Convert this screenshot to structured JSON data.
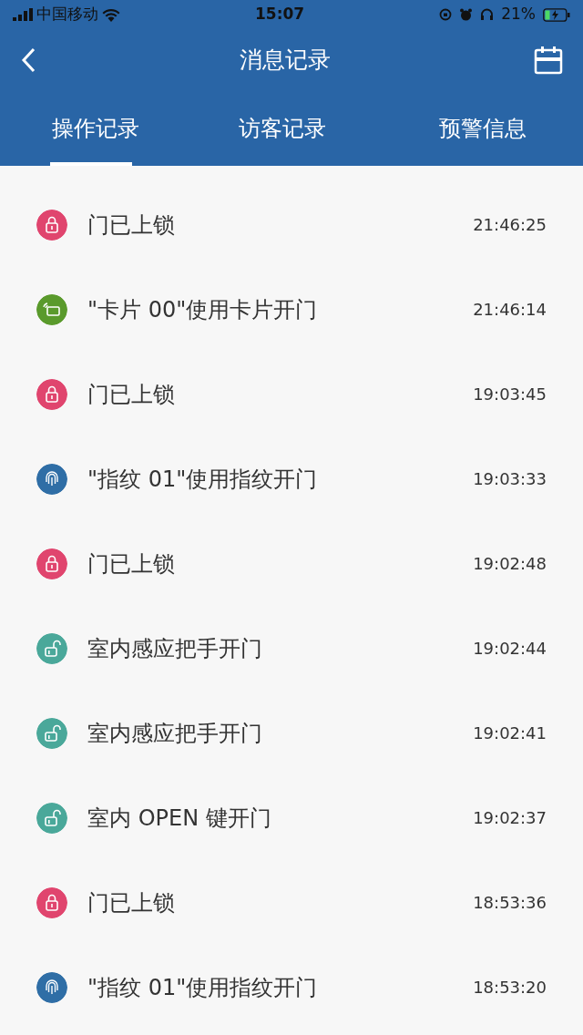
{
  "status_bar": {
    "carrier": "中国移动",
    "time": "15:07",
    "battery": "21%"
  },
  "header": {
    "title": "消息记录"
  },
  "tabs": [
    {
      "label": "操作记录",
      "selected": true
    },
    {
      "label": "访客记录",
      "selected": false
    },
    {
      "label": "预警信息",
      "selected": false
    }
  ],
  "records": [
    {
      "kind": "lock",
      "text": "门已上锁",
      "time": "21:46:25"
    },
    {
      "kind": "card",
      "text": "\"卡片 00\"使用卡片开门",
      "time": "21:46:14"
    },
    {
      "kind": "lock",
      "text": "门已上锁",
      "time": "19:03:45"
    },
    {
      "kind": "fingerprint",
      "text": "\"指纹 01\"使用指纹开门",
      "time": "19:03:33"
    },
    {
      "kind": "lock",
      "text": "门已上锁",
      "time": "19:02:48"
    },
    {
      "kind": "unlock",
      "text": "室内感应把手开门",
      "time": "19:02:44"
    },
    {
      "kind": "unlock",
      "text": "室内感应把手开门",
      "time": "19:02:41"
    },
    {
      "kind": "unlock",
      "text": "室内 OPEN 键开门",
      "time": "19:02:37"
    },
    {
      "kind": "lock",
      "text": "门已上锁",
      "time": "18:53:36"
    },
    {
      "kind": "fingerprint",
      "text": "\"指纹 01\"使用指纹开门",
      "time": "18:53:20"
    }
  ]
}
